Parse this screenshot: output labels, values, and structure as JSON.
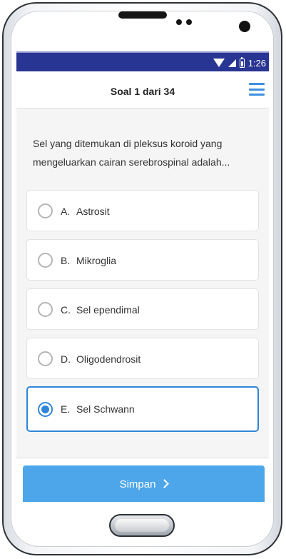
{
  "status_bar": {
    "time": "1:26"
  },
  "header": {
    "title": "Soal 1 dari 34",
    "menu_icon": "hamburger-menu-icon"
  },
  "question": {
    "text": "Sel yang ditemukan di pleksus koroid yang mengeluarkan cairan serebrospinal adalah..."
  },
  "options": [
    {
      "letter": "A.",
      "text": "Astrosit",
      "selected": false
    },
    {
      "letter": "B.",
      "text": "Mikroglia",
      "selected": false
    },
    {
      "letter": "C.",
      "text": "Sel ependimal",
      "selected": false
    },
    {
      "letter": "D.",
      "text": "Oligodendrosit",
      "selected": false
    },
    {
      "letter": "E.",
      "text": "Sel Schwann",
      "selected": true
    }
  ],
  "footer": {
    "submit_label": "Simpan",
    "submit_icon": "chevron-right-icon"
  },
  "colors": {
    "status_bar": "#283593",
    "accent": "#2f85d8",
    "button": "#4da6e9"
  }
}
